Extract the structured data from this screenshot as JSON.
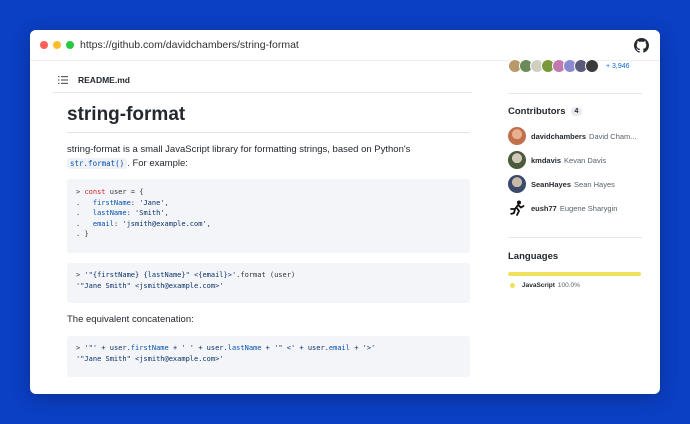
{
  "browser": {
    "url": "https://github.com/davidchambers/string-format"
  },
  "readme": {
    "filename": "README.md",
    "title": "string-format",
    "intro_before": "string-format is a small JavaScript library for formatting strings, based on Python's ",
    "intro_code": "str.format()",
    "intro_after": ". For example:",
    "concat_label": "The equivalent concatenation:"
  },
  "code1": {
    "lines": [
      {
        "prefix": "> ",
        "kw": "const",
        "rest": " user = {"
      },
      {
        "prefix": ".   ",
        "prop": "firstName",
        "colon": ": ",
        "str": "'Jane'",
        "end": ","
      },
      {
        "prefix": ".   ",
        "prop": "lastName",
        "colon": ": ",
        "str": "'Smith'",
        "end": ","
      },
      {
        "prefix": ".   ",
        "prop": "email",
        "colon": ": ",
        "str": "'jsmith@example.com'",
        "end": ","
      },
      {
        "prefix": ". ",
        "kw": "",
        "rest": "}"
      }
    ]
  },
  "code2": {
    "line1_prefix": "> ",
    "line1_str": "'\"{firstName} {lastName}\" <{email}>'",
    "line1_rest": ".format (user)",
    "line2": "'\"Jane Smith\" <jsmith@example.com>'"
  },
  "code3": {
    "line1_prefix": "> ",
    "line1_a": "'\"' + user.",
    "line1_b": "firstName",
    "line1_c": " + ' ' + user.",
    "line1_d": "lastName",
    "line1_e": " + '\" <' + user.",
    "line1_f": "email",
    "line1_g": " + '>'",
    "line2": "'\"Jane Smith\" <jsmith@example.com>'"
  },
  "sidebar": {
    "more_contributors": "+ 3,946",
    "contributors_title": "Contributors",
    "contributors_count": "4",
    "contributors": [
      {
        "login": "davidchambers",
        "name": "David Cham...",
        "color": "#c0704a"
      },
      {
        "login": "kmdavis",
        "name": "Kevan Davis",
        "color": "#4a5a3a"
      },
      {
        "login": "SeanHayes",
        "name": "Sean Hayes",
        "color": "#3a4a6a"
      },
      {
        "login": "eush77",
        "name": "Eugene Sharygin",
        "color": "#222222"
      }
    ],
    "languages_title": "Languages",
    "languages": [
      {
        "name": "JavaScript",
        "percent": "100.0%",
        "color": "#f1e05a",
        "fraction": 1.0
      }
    ]
  },
  "icons": {
    "readme": "list-icon",
    "brand": "github-icon"
  }
}
